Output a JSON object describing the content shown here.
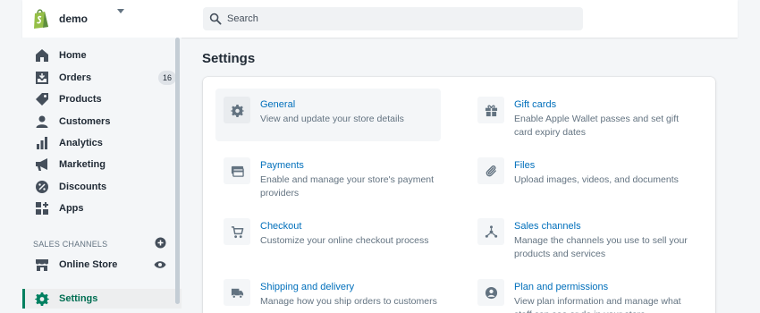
{
  "topbar": {
    "store_name": "demo",
    "search_placeholder": "Search"
  },
  "sidebar": {
    "items": [
      {
        "label": "Home",
        "icon": "home-icon"
      },
      {
        "label": "Orders",
        "icon": "orders-icon",
        "badge": "16"
      },
      {
        "label": "Products",
        "icon": "tag-icon"
      },
      {
        "label": "Customers",
        "icon": "person-icon"
      },
      {
        "label": "Analytics",
        "icon": "bar-chart-icon"
      },
      {
        "label": "Marketing",
        "icon": "megaphone-icon"
      },
      {
        "label": "Discounts",
        "icon": "discount-icon"
      },
      {
        "label": "Apps",
        "icon": "apps-icon"
      }
    ],
    "sales_channels_title": "SALES CHANNELS",
    "channels": [
      {
        "label": "Online Store",
        "icon": "store-icon"
      }
    ],
    "settings": {
      "label": "Settings",
      "icon": "gear-icon"
    }
  },
  "main": {
    "title": "Settings",
    "settings": [
      {
        "title": "General",
        "description": "View and update your store details",
        "icon": "gear-icon"
      },
      {
        "title": "Gift cards",
        "description": "Enable Apple Wallet passes and set gift card expiry dates",
        "icon": "gift-icon"
      },
      {
        "title": "Payments",
        "description": "Enable and manage your store's payment providers",
        "icon": "payment-icon"
      },
      {
        "title": "Files",
        "description": "Upload images, videos, and documents",
        "icon": "paperclip-icon"
      },
      {
        "title": "Checkout",
        "description": "Customize your online checkout process",
        "icon": "cart-icon"
      },
      {
        "title": "Sales channels",
        "description": "Manage the channels you use to sell your products and services",
        "icon": "channels-icon"
      },
      {
        "title": "Shipping and delivery",
        "description": "Manage how you ship orders to customers",
        "icon": "truck-icon"
      },
      {
        "title": "Plan and permissions",
        "description": "View plan information and manage what staff can see or do in your store",
        "icon": "account-icon"
      }
    ]
  },
  "colors": {
    "brand_green": "#95bf47",
    "link_blue": "#006fbb",
    "active_green": "#008060"
  }
}
